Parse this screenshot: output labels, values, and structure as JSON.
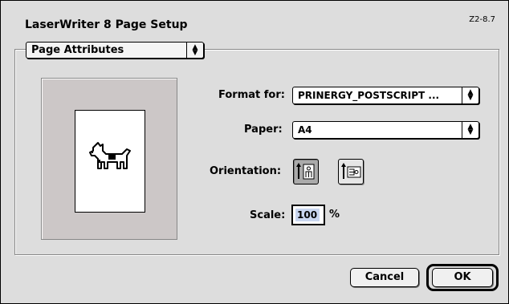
{
  "window": {
    "title": "LaserWriter 8 Page Setup",
    "version": "Z2-8.7"
  },
  "section": {
    "selected": "Page Attributes"
  },
  "format_for": {
    "label": "Format for:",
    "value": "PRINERGY_POSTSCRIPT ..."
  },
  "paper": {
    "label": "Paper:",
    "value": "A4"
  },
  "orientation": {
    "label": "Orientation:",
    "selected": "portrait",
    "options": [
      "portrait",
      "landscape"
    ]
  },
  "scale": {
    "label": "Scale:",
    "value": "100",
    "unit": "%"
  },
  "buttons": {
    "cancel": "Cancel",
    "ok": "OK"
  },
  "icons": [
    "dogcow-icon",
    "portrait-orientation-icon",
    "landscape-orientation-icon",
    "popup-arrows-icon"
  ],
  "colors": {
    "dialog_bg": "#dddddd",
    "preview_bg": "#ccc7c7",
    "selection": "#c9d6f0"
  }
}
